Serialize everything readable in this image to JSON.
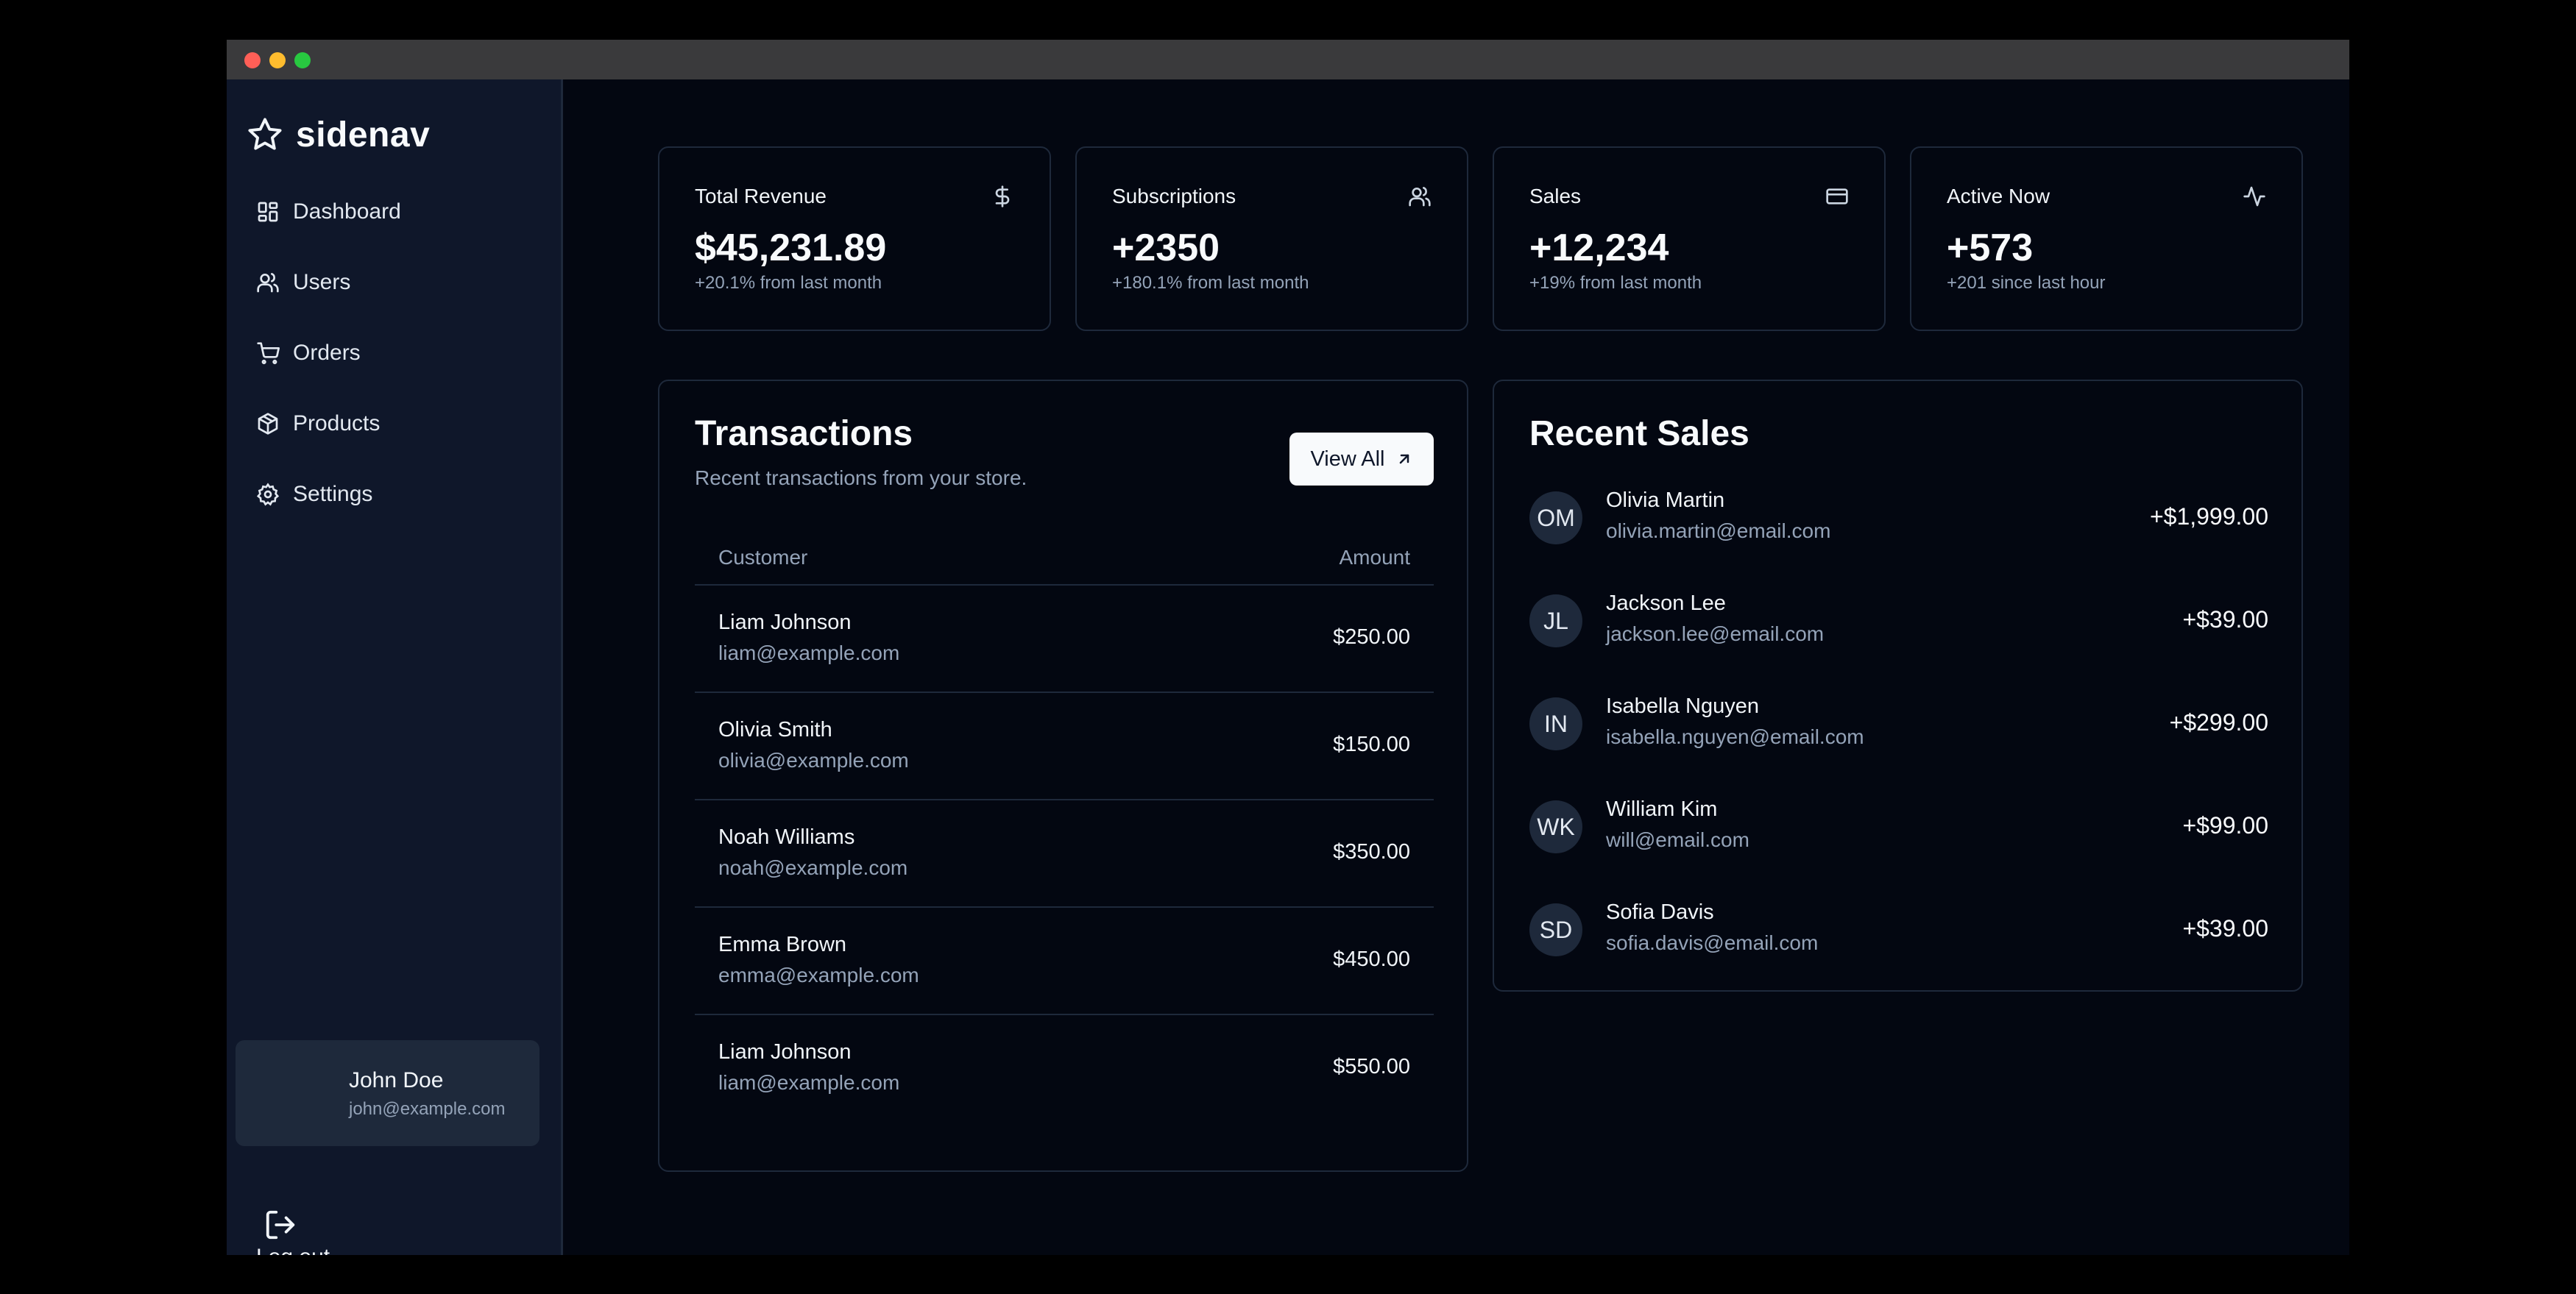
{
  "app": {
    "name": "sidenav"
  },
  "sidebar": {
    "items": [
      {
        "label": "Dashboard",
        "icon": "dashboard-icon"
      },
      {
        "label": "Users",
        "icon": "users-icon"
      },
      {
        "label": "Orders",
        "icon": "cart-icon"
      },
      {
        "label": "Products",
        "icon": "package-icon"
      },
      {
        "label": "Settings",
        "icon": "gear-icon"
      }
    ],
    "user": {
      "name": "John Doe",
      "email": "john@example.com"
    },
    "logout_label": "Log out"
  },
  "stats": [
    {
      "title": "Total Revenue",
      "value": "$45,231.89",
      "sub": "+20.1% from last month",
      "icon": "dollar-icon"
    },
    {
      "title": "Subscriptions",
      "value": "+2350",
      "sub": "+180.1% from last month",
      "icon": "users-icon"
    },
    {
      "title": "Sales",
      "value": "+12,234",
      "sub": "+19% from last month",
      "icon": "credit-card-icon"
    },
    {
      "title": "Active Now",
      "value": "+573",
      "sub": "+201 since last hour",
      "icon": "activity-icon"
    }
  ],
  "transactions": {
    "title": "Transactions",
    "subtitle": "Recent transactions from your store.",
    "view_all_label": "View All",
    "columns": {
      "customer": "Customer",
      "amount": "Amount"
    },
    "rows": [
      {
        "name": "Liam Johnson",
        "email": "liam@example.com",
        "amount": "$250.00"
      },
      {
        "name": "Olivia Smith",
        "email": "olivia@example.com",
        "amount": "$150.00"
      },
      {
        "name": "Noah Williams",
        "email": "noah@example.com",
        "amount": "$350.00"
      },
      {
        "name": "Emma Brown",
        "email": "emma@example.com",
        "amount": "$450.00"
      },
      {
        "name": "Liam Johnson",
        "email": "liam@example.com",
        "amount": "$550.00"
      }
    ]
  },
  "recent_sales": {
    "title": "Recent Sales",
    "items": [
      {
        "initials": "OM",
        "name": "Olivia Martin",
        "email": "olivia.martin@email.com",
        "amount": "+$1,999.00"
      },
      {
        "initials": "JL",
        "name": "Jackson Lee",
        "email": "jackson.lee@email.com",
        "amount": "+$39.00"
      },
      {
        "initials": "IN",
        "name": "Isabella Nguyen",
        "email": "isabella.nguyen@email.com",
        "amount": "+$299.00"
      },
      {
        "initials": "WK",
        "name": "William Kim",
        "email": "will@email.com",
        "amount": "+$99.00"
      },
      {
        "initials": "SD",
        "name": "Sofia Davis",
        "email": "sofia.davis@email.com",
        "amount": "+$39.00"
      }
    ]
  }
}
